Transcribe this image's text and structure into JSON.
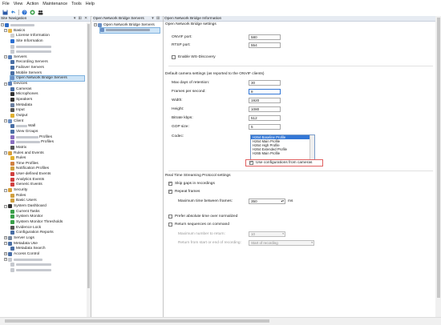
{
  "menu": [
    "File",
    "View",
    "Action",
    "Maintenance",
    "Tools",
    "Help"
  ],
  "toolbar_icons": [
    "save-icon",
    "undo-icon",
    "help-icon",
    "dashboard-icon",
    "users-icon"
  ],
  "nav": {
    "title": "Site Navigation",
    "pins": "▾ ⊞ ✕",
    "items": [
      {
        "label": "Basics",
        "icon": "folder-icon",
        "level": 1,
        "expander": "−"
      },
      {
        "label": "License Information",
        "icon": "license-icon",
        "level": 2
      },
      {
        "label": "Site Information",
        "icon": "info-icon",
        "level": 2
      },
      {
        "label": "",
        "icon": "blur-icon",
        "level": 2
      },
      {
        "label": "",
        "icon": "blur-icon",
        "level": 2
      },
      {
        "label": "Servers",
        "icon": "server-icon",
        "level": 1,
        "expander": "−"
      },
      {
        "label": "Recording Servers",
        "icon": "recording-server-icon",
        "level": 2
      },
      {
        "label": "Failover Servers",
        "icon": "failover-icon",
        "level": 2
      },
      {
        "label": "Mobile Servers",
        "icon": "mobile-icon",
        "level": 2
      },
      {
        "label": "Open Network Bridge Servers",
        "icon": "bridge-icon",
        "level": 2,
        "selected": true
      },
      {
        "label": "Devices",
        "icon": "devices-icon",
        "level": 1,
        "expander": "−"
      },
      {
        "label": "Cameras",
        "icon": "camera-icon",
        "level": 2
      },
      {
        "label": "Microphones",
        "icon": "microphone-icon",
        "level": 2
      },
      {
        "label": "Speakers",
        "icon": "speaker-icon",
        "level": 2
      },
      {
        "label": "Metadata",
        "icon": "metadata-icon",
        "level": 2
      },
      {
        "label": "Input",
        "icon": "input-icon",
        "level": 2
      },
      {
        "label": "Output",
        "icon": "output-icon",
        "level": 2
      },
      {
        "label": "Client",
        "icon": "client-icon",
        "level": 1,
        "expander": "−"
      },
      {
        "label": "Wall",
        "icon": "wall-icon",
        "level": 2,
        "blur": 14
      },
      {
        "label": "View Groups",
        "icon": "view-groups-icon",
        "level": 2
      },
      {
        "label": "Profiles",
        "icon": "profile-icon",
        "level": 2,
        "blur": 28
      },
      {
        "label": "Profiles",
        "icon": "profile-icon",
        "level": 2,
        "blur": 30
      },
      {
        "label": "Matrix",
        "icon": "matrix-icon",
        "level": 2
      },
      {
        "label": "Rules and Events",
        "icon": "rules-events-icon",
        "level": 1,
        "expander": "−"
      },
      {
        "label": "Rules",
        "icon": "rules-icon",
        "level": 2
      },
      {
        "label": "Time Profiles",
        "icon": "time-profile-icon",
        "level": 2
      },
      {
        "label": "Notification Profiles",
        "icon": "notification-icon",
        "level": 2
      },
      {
        "label": "User-defined Events",
        "icon": "user-event-icon",
        "level": 2
      },
      {
        "label": "Analytics Events",
        "icon": "analytics-icon",
        "level": 2
      },
      {
        "label": "Generic Events",
        "icon": "generic-event-icon",
        "level": 2
      },
      {
        "label": "Security",
        "icon": "security-icon",
        "level": 1,
        "expander": "−"
      },
      {
        "label": "Roles",
        "icon": "roles-icon",
        "level": 2
      },
      {
        "label": "Basic Users",
        "icon": "basic-users-icon",
        "level": 2
      },
      {
        "label": "System Dashboard",
        "icon": "dashboard-icon",
        "level": 1,
        "expander": "−"
      },
      {
        "label": "Current Tasks",
        "icon": "tasks-icon",
        "level": 2
      },
      {
        "label": "System Monitor",
        "icon": "monitor-icon",
        "level": 2
      },
      {
        "label": "System Monitor Thresholds",
        "icon": "thresholds-icon",
        "level": 2
      },
      {
        "label": "Evidence Lock",
        "icon": "evidence-lock-icon",
        "level": 2
      },
      {
        "label": "Configuration Reports",
        "icon": "report-icon",
        "level": 2
      },
      {
        "label": "Server Logs",
        "icon": "logs-icon",
        "level": 1,
        "expander": "+"
      },
      {
        "label": "Metadata Use",
        "icon": "metadata-use-icon",
        "level": 1,
        "expander": "−"
      },
      {
        "label": "Metadata Search",
        "icon": "metadata-search-icon",
        "level": 2
      },
      {
        "label": "Access Control",
        "icon": "access-control-icon",
        "level": 1,
        "expander": "+"
      },
      {
        "label": "",
        "icon": "blur-icon",
        "level": 1,
        "expander": "+"
      },
      {
        "label": "",
        "icon": "blur-icon",
        "level": 2
      },
      {
        "label": "",
        "icon": "blur-icon",
        "level": 2
      }
    ]
  },
  "mid": {
    "title": "Open Network Bridge Servers",
    "pins": "▾ ⊞",
    "root": "Open Network Bridge Servers"
  },
  "props": {
    "title": "Open Network Bridge Information",
    "settings_header": "Open Network Bridge settings",
    "onvif_port_label": "ONVIF port:",
    "onvif_port": "580",
    "rtsp_port_label": "RTSP port:",
    "rtsp_port": "554",
    "ws_discovery": "Enable WS-Discovery",
    "camera_header": "Default camera settings (as reported to the ONVIF clients)",
    "retention_label": "Max days of retention:",
    "retention": "30",
    "fps_label": "Frames per second:",
    "fps": "8",
    "width_label": "Width:",
    "width": "1920",
    "height_label": "Height:",
    "height": "1080",
    "bitrate_label": "Bitrate kbps:",
    "bitrate": "512",
    "gop_label": "GOP size:",
    "gop": "5",
    "codec_label": "Codec:",
    "codecs": [
      "H264 Baseline Profile",
      "H264 Main Profile",
      "H264 High Profile",
      "H264 Extended Profile",
      "H265 Main Profile"
    ],
    "use_camera_config": "Use configurations from cameras",
    "rtsp_header": "Real Time Streaming Protocol settings",
    "skip_gaps": "Skip gaps in recordings",
    "repeat_frames": "Repeat frames",
    "max_time_label": "Maximum time between frames:",
    "max_time": "350",
    "max_time_unit": "ms",
    "prefer_abs": "Prefer absolute time over normalized",
    "return_seq": "Return sequences on command",
    "max_number_label": "Maximum number to return:",
    "max_number": "10",
    "return_from_label": "Return from start or end of recording:",
    "return_from": "Start of recording"
  }
}
